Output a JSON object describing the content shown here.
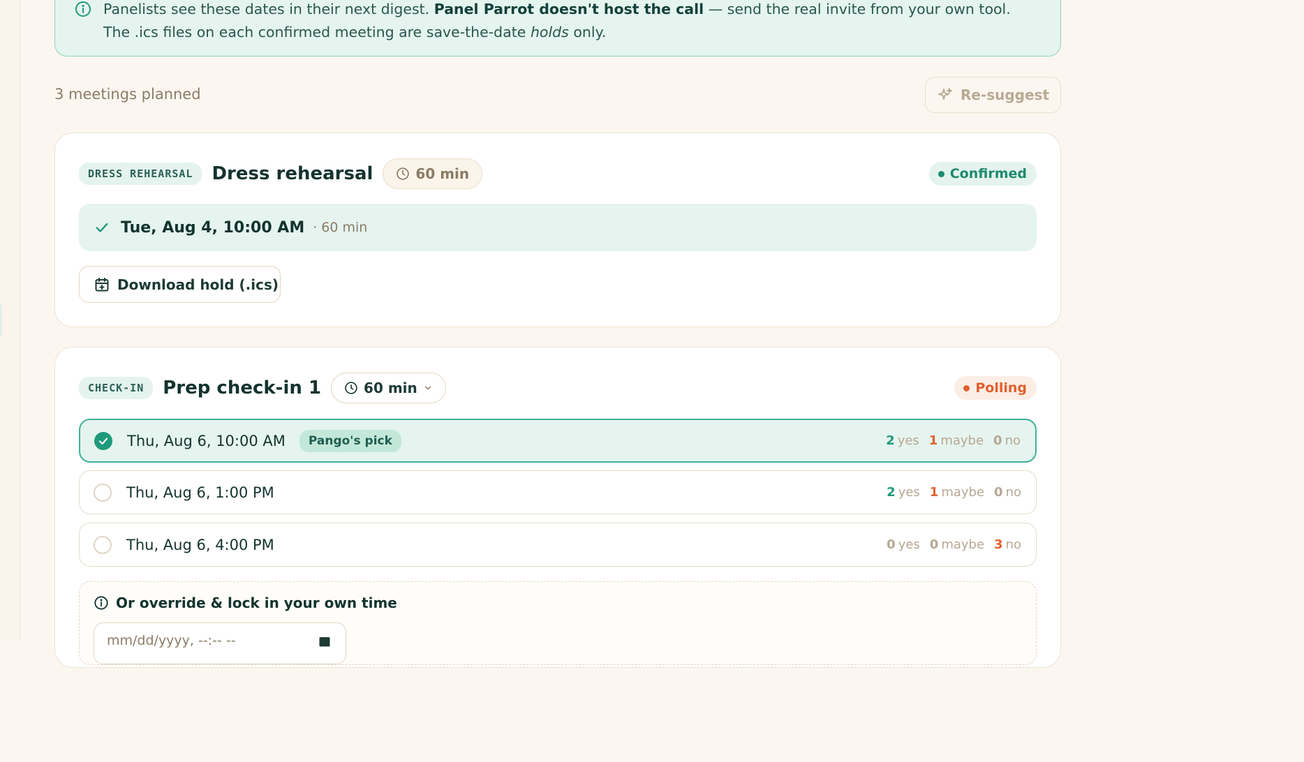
{
  "banner": {
    "text_part1": "Panelists see these dates in their next digest. ",
    "text_bold": "Panel Parrot doesn't host the call",
    "text_part2": " — send the real invite from your own tool. The .ics files on each confirmed meeting are save-the-date ",
    "text_italic": "holds",
    "text_part3": " only.",
    "icon": "info-icon"
  },
  "summary": {
    "count_text": "3 meetings planned",
    "resuggest_label": "Re-suggest",
    "resuggest_icon": "sparkle-icon"
  },
  "colors": {
    "accent": "#1e9a7a",
    "polling": "#e0612f",
    "background": "#fbf6ef"
  },
  "meetings": [
    {
      "type_label": "DRESS REHEARSAL",
      "title": "Dress rehearsal",
      "duration": "60 min",
      "status": "Confirmed",
      "confirmed_time": "Tue, Aug 4, 10:00 AM",
      "confirmed_duration": "· 60 min",
      "download_label": "Download hold (.ics)"
    },
    {
      "type_label": "CHECK-IN",
      "title": "Prep check-in 1",
      "duration": "60 min",
      "status": "Polling",
      "options": [
        {
          "time": "Thu, Aug 6, 10:00 AM",
          "pick_label": "Pango's pick",
          "selected": true,
          "yes": "2",
          "maybe": "1",
          "no": "0"
        },
        {
          "time": "Thu, Aug 6, 1:00 PM",
          "selected": false,
          "yes": "2",
          "maybe": "1",
          "no": "0"
        },
        {
          "time": "Thu, Aug 6, 4:00 PM",
          "selected": false,
          "yes": "0",
          "maybe": "0",
          "no": "3"
        }
      ],
      "vote_labels": {
        "yes": "yes",
        "maybe": "maybe",
        "no": "no"
      },
      "override_label": "Or override & lock in your own time",
      "override_placeholder": "mm/dd/yyyy, --:-- --"
    }
  ]
}
